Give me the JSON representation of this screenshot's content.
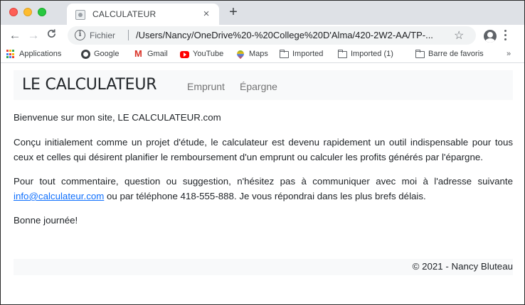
{
  "browser": {
    "tab_title": "CALCULATEUR",
    "tab_close": "×",
    "new_tab": "+",
    "nav": {
      "back": "←",
      "forward": "→",
      "reload": "C"
    },
    "address": {
      "security_label": "Fichier",
      "url": "/Users/Nancy/OneDrive%20-%20College%20D'Alma/420-2W2-AA/TP-..."
    },
    "bookmarks": [
      {
        "label": "Applications",
        "icon": "apps-icon"
      },
      {
        "label": "Google",
        "icon": "google-icon"
      },
      {
        "label": "Gmail",
        "icon": "gmail-icon"
      },
      {
        "label": "YouTube",
        "icon": "youtube-icon"
      },
      {
        "label": "Maps",
        "icon": "maps-icon"
      },
      {
        "label": "Imported",
        "icon": "folder-icon"
      },
      {
        "label": "Imported (1)",
        "icon": "folder-icon"
      },
      {
        "label": "Barre de favoris",
        "icon": "folder-icon"
      }
    ],
    "bookmarks_more": "»"
  },
  "page": {
    "brand": "LE CALCULATEUR",
    "nav_links": [
      "Emprunt",
      "Épargne"
    ],
    "welcome": "Bienvenue sur mon site, LE CALCULATEUR.com",
    "intro": "Conçu initialement comme un projet d'étude, le calculateur est devenu rapidement un outil indispensable pour tous ceux et celles qui désirent planifier le remboursement d'un emprunt ou calculer les profits générés par l'épargne.",
    "contact_before": "Pour tout commentaire, question ou suggestion, n'hésitez pas à communiquer avec moi à l'adresse suivante ",
    "contact_email": "info@calculateur.com",
    "contact_after": " ou par téléphone 418-555-888. Je vous répondrai dans les plus brefs délais.",
    "closing": "Bonne journée!",
    "footer": "© 2021 - Nancy Bluteau"
  },
  "colors": {
    "link": "#0d6efd",
    "navbar_bg": "#f8f9fa",
    "tabstrip_bg": "#dee1e6"
  }
}
